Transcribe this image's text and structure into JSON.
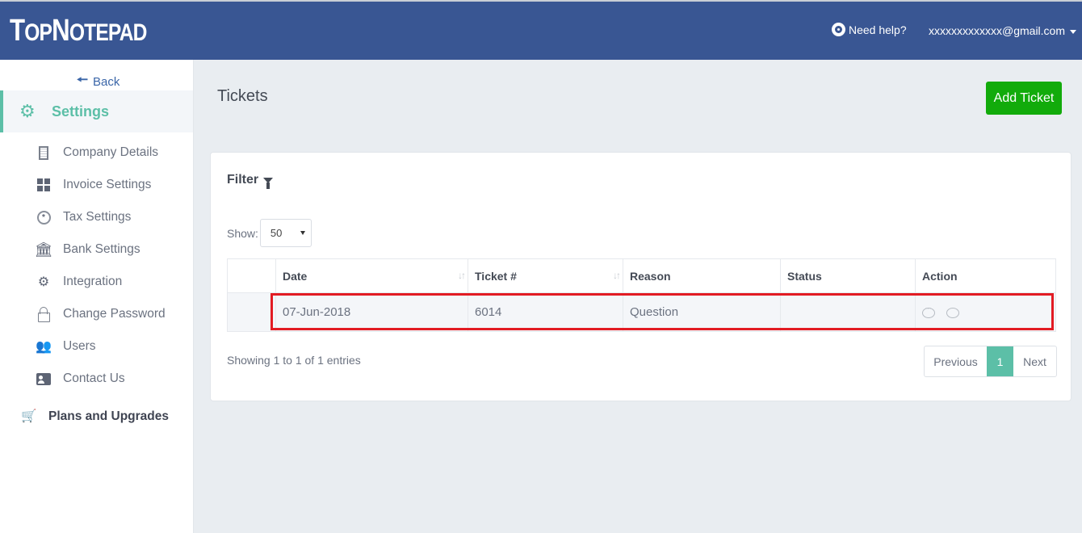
{
  "header": {
    "logo": "TopNotepad",
    "help_label": "Need help?",
    "user_email": "xxxxxxxxxxxxx@gmail.com"
  },
  "sidebar": {
    "back_label": "Back",
    "active_section": "Settings",
    "items": [
      {
        "label": "Company Details",
        "icon": "building-icon"
      },
      {
        "label": "Invoice Settings",
        "icon": "grid-icon"
      },
      {
        "label": "Tax Settings",
        "icon": "tax-icon"
      },
      {
        "label": "Bank Settings",
        "icon": "bank-icon"
      },
      {
        "label": "Integration",
        "icon": "cogs-icon"
      },
      {
        "label": "Change Password",
        "icon": "lock-icon"
      },
      {
        "label": "Users",
        "icon": "users-icon"
      },
      {
        "label": "Contact Us",
        "icon": "contact-card-icon"
      }
    ],
    "plans_label": "Plans and Upgrades"
  },
  "main": {
    "title": "Tickets",
    "add_button": "Add Ticket",
    "filter_label": "Filter",
    "show_label": "Show:",
    "page_size": "50",
    "table": {
      "columns": [
        "",
        "Date",
        "Ticket #",
        "Reason",
        "Status",
        "Action"
      ],
      "rows": [
        {
          "date": "07-Jun-2018",
          "ticket": "6014",
          "reason": "Question",
          "status": ""
        }
      ]
    },
    "showing_text": "Showing 1 to 1 of 1 entries",
    "pagination": {
      "previous": "Previous",
      "current": "1",
      "next": "Next"
    }
  },
  "colors": {
    "header_bg": "#395693",
    "accent": "#5cbfa7",
    "add_button": "#12ab0b",
    "highlight": "#e21b23"
  }
}
